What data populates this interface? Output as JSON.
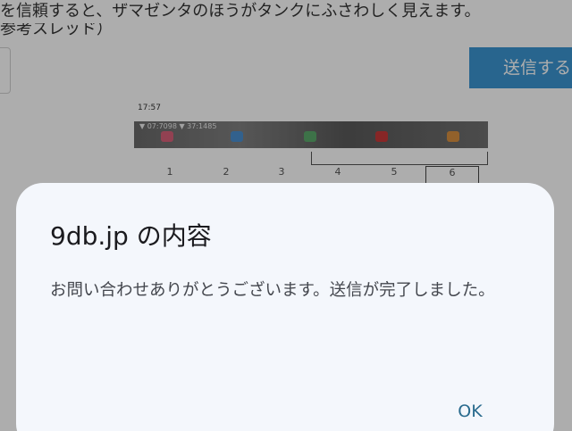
{
  "background": {
    "top_text": "を信頼すると、ザマゼンタのほうがタンクにふさわしく見えます。",
    "top_text2": "参考スレッド）",
    "send_button_label": "送信する",
    "screenshot": {
      "time": "17:57",
      "bar_text": "▼ 07:7098 ▼ 37:1485",
      "icons": [
        "pink-icon",
        "blue-icon",
        "green-icon",
        "red-icon",
        "orange-icon"
      ],
      "numbers": [
        "1",
        "2",
        "3",
        "4",
        "5",
        "6"
      ]
    }
  },
  "dialog": {
    "title": "9db.jp の内容",
    "message": "お問い合わせありがとうございます。送信が完了しました。",
    "ok_label": "OK"
  },
  "colors": {
    "dialog_bg": "#f4f7fc",
    "accent": "#2a6b8e",
    "send_button": "#3b95d2"
  }
}
